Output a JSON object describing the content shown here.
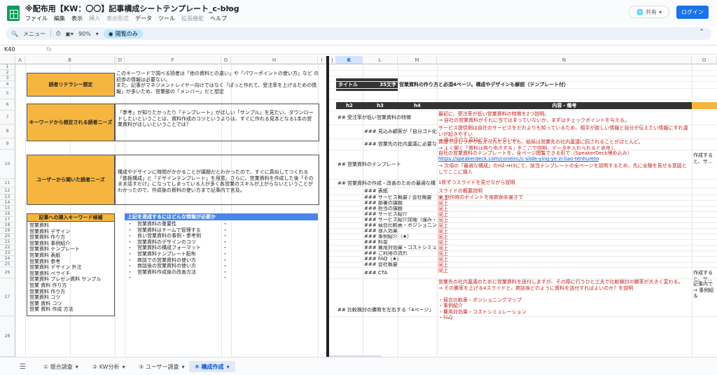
{
  "title_bar": {
    "doc_title": "※配布用【KW：〇〇】記事構成シートテンプレート_c-blog",
    "menu": [
      {
        "label": "ファイル",
        "disabled": false
      },
      {
        "label": "編集",
        "disabled": false
      },
      {
        "label": "表示",
        "disabled": false
      },
      {
        "label": "挿入",
        "disabled": true
      },
      {
        "label": "表示形式",
        "disabled": true
      },
      {
        "label": "データ",
        "disabled": false
      },
      {
        "label": "ツール",
        "disabled": false
      },
      {
        "label": "拡張機能",
        "disabled": true
      },
      {
        "label": "ヘルプ",
        "disabled": false
      }
    ],
    "share_label": "共有",
    "login_label": "ログイン"
  },
  "toolbar": {
    "menu_search": "メニュー",
    "zoom": "90%",
    "view_only": "閲覧のみ"
  },
  "formula_bar": {
    "name_box": "K40",
    "fx": "fx"
  },
  "columns_left": [
    "A",
    "B",
    "C",
    "D",
    "E",
    "F",
    "G",
    "H",
    "I"
  ],
  "columns_right": [
    "J",
    "K",
    "L",
    "M",
    "N",
    "O"
  ],
  "rows": [
    "1",
    "2",
    "3",
    "4",
    "5",
    "6",
    "7",
    "8",
    "9",
    "10",
    "11",
    "12",
    "13",
    "14",
    "15",
    "16",
    "17",
    "18",
    "19",
    "20",
    "21",
    "22",
    "23",
    "24",
    "25",
    "26",
    "27",
    "28"
  ],
  "left_panel": {
    "literacy_label": "読者リテラシー想定",
    "literacy_text": "このキーワードで調べる読者は「他の資料との違い」や「パワーポイントの使い方」など の初歩の情報は必要ない。\nまた、記事がマネジメントレイヤー向けではなく「ぱっと作れて、受注率を上げるための情報」が多いため、営業部の「メンバー」だと想定",
    "needs_label": "キーワードから想定される読者ニーズ",
    "needs_text": "「参考」が知りたかったり「テンプレート」がほしい「サンプル」を見たい、ダウンロードしたいということは、資料作成のコツというよりは、すぐに作れる見本となる1本の営業資料がほしいということでは？",
    "interview_label": "ユーザーから聞いた読者ニーズ",
    "interview_text": "構成やデザインに時間がかかることが課題だとわかったので、すぐに真似してつくれる「鉄板構成」と「デザインテンプレート」を用意。さらに、営業資料を作成した後「そのまま話すだけ」になってしまっている人が多く各営業のスキルが上がらないということがわかったので、作成後の資料の使い方まで記事内で言及。",
    "kw_header": "記事への挿入キーワード候補",
    "keywords": [
      "営業資料",
      "営業資料 デザイン",
      "営業資料 作り方",
      "営業資料 事例紹介",
      "営業資料 テンプレート",
      "営業資料 表紙",
      "営業資料 参考",
      "営業資料 デザイン 外注",
      "営業資料 ペライチ",
      "営業資料 プレゼン資料 サンプル",
      "営業 資料 作り方",
      "営業資料 作り方",
      "営業資料 コツ",
      "営業 資料 コツ",
      "営業 資料 作成 方法"
    ],
    "info_header": "上記を達成するにはどんな情報が必要か",
    "info_items": [
      "営業資料の重要性",
      "営業資料はチームで管理する",
      "良い営業資料の事例・参考例",
      "営業資料のデザインのコツ",
      "営業資料の構成フォーマット",
      "営業資料テンプレート配布",
      "商談での営業資料の使い方",
      "商談後の営業資料の使い方",
      "営業資料作成後の改善方法",
      ""
    ]
  },
  "right_panel": {
    "title_label": "タイトル",
    "char_count": "35文字",
    "title_value": "営業資料の作り方と必須4ページ。構成やデザインも解説（テンプレート付）",
    "headers": {
      "h2": "h2",
      "h3": "h3",
      "h4": "h4",
      "notes": "内容・備考"
    },
    "outline": [
      {
        "heading": "## 受注率が低い営業資料の特徴",
        "notes": "最初に、受注率が低い営業資料の特徴を2つ説明。\n→ 自社の営業資料がそれに当てはまっていないか、まずはチェックポイントを与える。"
      },
      {
        "heading": "### 見込み顧客が「自分ゴト化」を起きやすい",
        "notes": "サービス提供側は自社のサービスをだれよりも知っているため、相手が欲しい情報と自分が伝えたい情報にすれ違いが起きやすい\n→ 自分本位な資料になっていないか"
      },
      {
        "heading": "### 営業先の社内稟議に必要な情報",
        "notes": "商談ではしっかり伝えられたとしても、結局は営業先の社内稟議に回されることがほとんど。\n→ よく聞く「資料は独り歩きする」をここで説明。データを入れられると尚良し"
      },
      {
        "heading": "## 営業資料のテンプレート",
        "notes": "自社の営業資料のテンプレートを、全ページ閲覧できる形で（SpeakerDeck埋め込み）",
        "link": "https://speakerdeck.com/coneinc/c-slide-ying-ye-zi-liao-tenhureto",
        "notes2": "→ 次項の「最適な構成」のH2→H3にて、該当テンプレートの全ページを説明するため、先に全験を見せる意図としてここに挿入",
        "extra": "作成すると、サ..."
      },
      {
        "heading": "## 営業資料の作成・改善のための最適な構成",
        "notes": "1枚ずつスライドを見せながら説明"
      },
      {
        "heading": "### 表紙",
        "notes": "スライドの概要説明\n＋ 制作時のポイントを複数箇条書きで"
      },
      {
        "heading": "### サービス概要 / 会社概要",
        "notes": "同上"
      },
      {
        "heading": "### 部署の課題",
        "notes": "同上"
      },
      {
        "heading": "### 担当の課題",
        "notes": "同上"
      },
      {
        "heading": "### サービス紹介",
        "notes": "同上"
      },
      {
        "heading": "### サービス紹介詳細（強み・特徴）",
        "notes": "同上"
      },
      {
        "heading": "### 競合比較表・ポジショニングマップ",
        "notes": "同上"
      },
      {
        "heading": "### 導入効果",
        "notes": "同上"
      },
      {
        "heading": "### 事例紹介（★）",
        "notes": "同上"
      },
      {
        "heading": "### 料金",
        "notes": "同上"
      },
      {
        "heading": "### 費用対効果・コストシミュレーション",
        "notes": "同上"
      },
      {
        "heading": "### ご利用の流れ",
        "notes": "同上"
      },
      {
        "heading": "### FAQ（★）",
        "notes": "同上"
      },
      {
        "heading": "### 会社概要",
        "notes": "同上"
      },
      {
        "heading": "### CTA",
        "notes": "同上",
        "extra": "作成すると、サ..."
      },
      {
        "heading": "## 比較検討の勝敗を左右する「4ページ」",
        "notes": "営業先の社内稟議のために営業資料を送付しますが、その際に行うひと工夫で比較検討の勝率が大きく変わる。\n→ その勝率を上げる4スライドと、商談後どのように資料を送付すればよいのか？を説明\n\n・競合比較表・ポジショニングマップ\n・事例紹介\n・費用対効果・コストシミュレーション\n・FAQ",
        "extra": "記事内で\n→ 事例紹\n＆"
      }
    ]
  },
  "sheet_tabs": [
    "① 競合調査",
    "② KW分析",
    "③ ユーザー調査",
    "④ 構成作成"
  ],
  "active_tab": "④ 構成作成",
  "selected_column": "K"
}
